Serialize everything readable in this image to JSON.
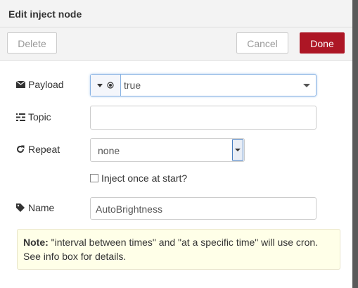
{
  "dialog": {
    "title": "Edit inject node"
  },
  "toolbar": {
    "delete_label": "Delete",
    "cancel_label": "Cancel",
    "done_label": "Done"
  },
  "form": {
    "payload": {
      "label": "Payload",
      "type_icon": "radio-dot-icon",
      "value": "true"
    },
    "topic": {
      "label": "Topic",
      "value": ""
    },
    "repeat": {
      "label": "Repeat",
      "value": "none"
    },
    "inject_once": {
      "label": "Inject once at start?",
      "checked": false
    },
    "name": {
      "label": "Name",
      "value": "AutoBrightness"
    }
  },
  "note": {
    "prefix": "Note:",
    "line1": " \"interval between times\" and \"at a specific time\" will use cron.",
    "line2": "See info box for details."
  },
  "colors": {
    "done_button": "#ad1625",
    "note_bg": "#ffffe8"
  }
}
